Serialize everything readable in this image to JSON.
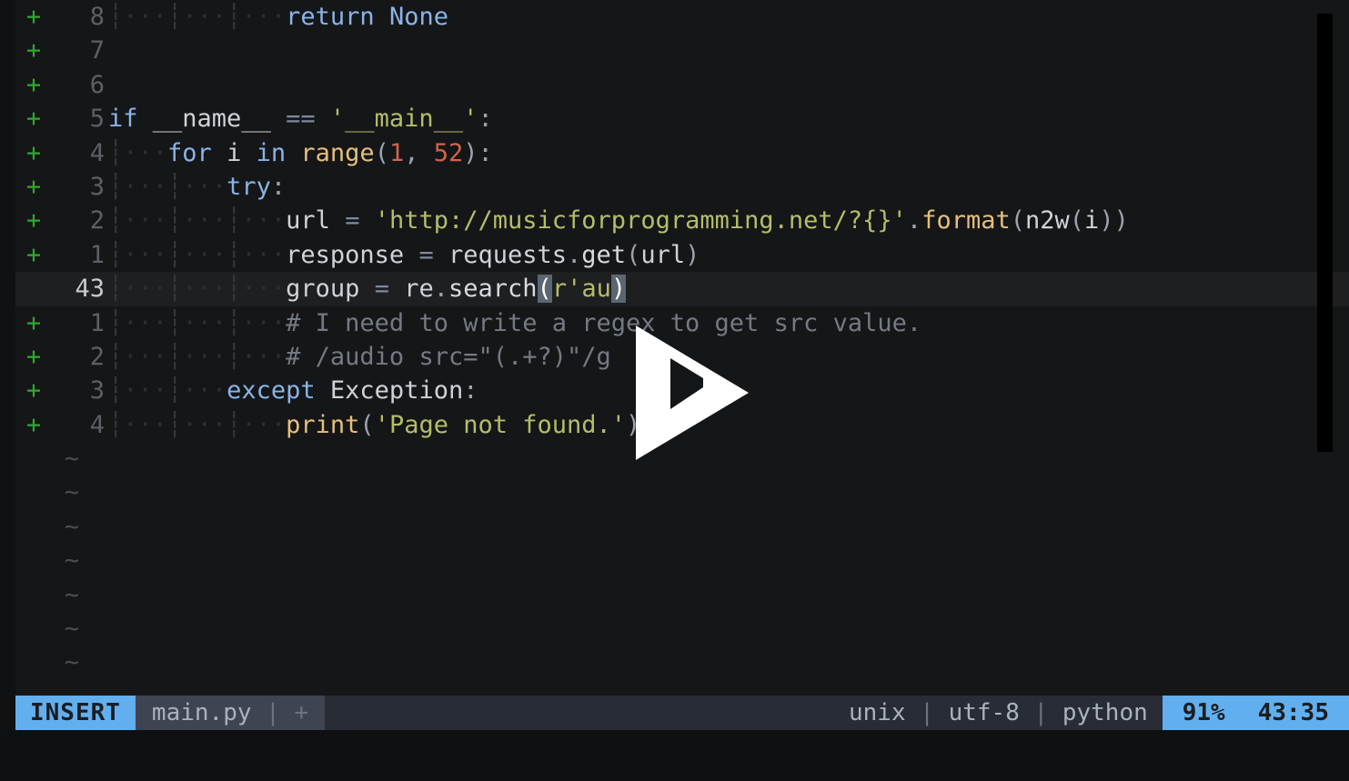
{
  "window": {
    "background": "#151618",
    "accent": "#61afef",
    "git_add_color": "#2fa82f"
  },
  "editor": {
    "filetype": "python",
    "current_line_number": "43",
    "lines": [
      {
        "sign": "+",
        "num": "8",
        "current": false,
        "indent_guides": 3,
        "code_tokens": [
          {
            "t": "return",
            "c": "kw"
          },
          {
            "t": " ",
            "c": "plain"
          },
          {
            "t": "None",
            "c": "builtin"
          }
        ]
      },
      {
        "sign": "+",
        "num": "7",
        "current": false,
        "indent_guides": 0,
        "code_tokens": []
      },
      {
        "sign": "+",
        "num": "6",
        "current": false,
        "indent_guides": 0,
        "code_tokens": []
      },
      {
        "sign": "+",
        "num": "5",
        "current": false,
        "indent_guides": 0,
        "code_tokens": [
          {
            "t": "if",
            "c": "kw"
          },
          {
            "t": " ",
            "c": "plain"
          },
          {
            "t": "__name__",
            "c": "ident"
          },
          {
            "t": " ",
            "c": "plain"
          },
          {
            "t": "==",
            "c": "op"
          },
          {
            "t": " ",
            "c": "plain"
          },
          {
            "t": "'__main__'",
            "c": "str"
          },
          {
            "t": ":",
            "c": "punct"
          }
        ]
      },
      {
        "sign": "+",
        "num": "4",
        "current": false,
        "indent_guides": 1,
        "code_tokens": [
          {
            "t": "for",
            "c": "kw"
          },
          {
            "t": " ",
            "c": "plain"
          },
          {
            "t": "i",
            "c": "ident"
          },
          {
            "t": " ",
            "c": "plain"
          },
          {
            "t": "in",
            "c": "kw"
          },
          {
            "t": " ",
            "c": "plain"
          },
          {
            "t": "range",
            "c": "fn"
          },
          {
            "t": "(",
            "c": "punct"
          },
          {
            "t": "1",
            "c": "num"
          },
          {
            "t": ", ",
            "c": "punct"
          },
          {
            "t": "52",
            "c": "num"
          },
          {
            "t": "):",
            "c": "punct"
          }
        ]
      },
      {
        "sign": "+",
        "num": "3",
        "current": false,
        "indent_guides": 2,
        "code_tokens": [
          {
            "t": "try",
            "c": "kw"
          },
          {
            "t": ":",
            "c": "punct"
          }
        ]
      },
      {
        "sign": "+",
        "num": "2",
        "current": false,
        "indent_guides": 3,
        "code_tokens": [
          {
            "t": "url",
            "c": "ident"
          },
          {
            "t": " ",
            "c": "plain"
          },
          {
            "t": "=",
            "c": "op"
          },
          {
            "t": " ",
            "c": "plain"
          },
          {
            "t": "'http://musicforprogramming.net/?{}'",
            "c": "str"
          },
          {
            "t": ".",
            "c": "punct"
          },
          {
            "t": "format",
            "c": "fn"
          },
          {
            "t": "(",
            "c": "punct"
          },
          {
            "t": "n2w",
            "c": "ident"
          },
          {
            "t": "(",
            "c": "punct"
          },
          {
            "t": "i",
            "c": "ident"
          },
          {
            "t": "))",
            "c": "punct"
          }
        ]
      },
      {
        "sign": "+",
        "num": "1",
        "current": false,
        "indent_guides": 3,
        "code_tokens": [
          {
            "t": "response",
            "c": "ident"
          },
          {
            "t": " ",
            "c": "plain"
          },
          {
            "t": "=",
            "c": "op"
          },
          {
            "t": " ",
            "c": "plain"
          },
          {
            "t": "requests",
            "c": "ident"
          },
          {
            "t": ".",
            "c": "punct"
          },
          {
            "t": "get",
            "c": "attr"
          },
          {
            "t": "(",
            "c": "punct"
          },
          {
            "t": "url",
            "c": "ident"
          },
          {
            "t": ")",
            "c": "punct"
          }
        ]
      },
      {
        "sign": "",
        "num": "43",
        "current": true,
        "indent_guides": 3,
        "code_tokens": [
          {
            "t": "group",
            "c": "ident"
          },
          {
            "t": " ",
            "c": "plain"
          },
          {
            "t": "=",
            "c": "op"
          },
          {
            "t": " ",
            "c": "plain"
          },
          {
            "t": "re",
            "c": "ident"
          },
          {
            "t": ".",
            "c": "punct"
          },
          {
            "t": "search",
            "c": "attr"
          },
          {
            "t": "(",
            "c": "match"
          },
          {
            "t": "r'au",
            "c": "str"
          },
          {
            "t": ")",
            "c": "match"
          }
        ]
      },
      {
        "sign": "+",
        "num": "1",
        "current": false,
        "indent_guides": 3,
        "code_tokens": [
          {
            "t": "# I need to write a regex to get src value.",
            "c": "comment"
          }
        ]
      },
      {
        "sign": "+",
        "num": "2",
        "current": false,
        "indent_guides": 3,
        "code_tokens": [
          {
            "t": "# /audio src=\"(.+?)\"/g",
            "c": "comment"
          }
        ]
      },
      {
        "sign": "+",
        "num": "3",
        "current": false,
        "indent_guides": 2,
        "code_tokens": [
          {
            "t": "except",
            "c": "kw"
          },
          {
            "t": " ",
            "c": "plain"
          },
          {
            "t": "Exception",
            "c": "exc"
          },
          {
            "t": ":",
            "c": "punct"
          }
        ]
      },
      {
        "sign": "+",
        "num": "4",
        "current": false,
        "indent_guides": 3,
        "code_tokens": [
          {
            "t": "print",
            "c": "fn"
          },
          {
            "t": "(",
            "c": "punct"
          },
          {
            "t": "'Page not found.'",
            "c": "str"
          },
          {
            "t": ")",
            "c": "punct"
          }
        ]
      }
    ],
    "empty_line_marker": "~",
    "empty_line_count": 7
  },
  "scrollbar": {
    "name": "vertical-scrollbar"
  },
  "cursor_overlay": {
    "icon": "play-cursor-icon"
  },
  "statusbar": {
    "mode": "INSERT",
    "filename": "main.py",
    "file_separator": "|",
    "modified_flag": "+",
    "fileformat": "unix",
    "encoding": "utf-8",
    "language": "python",
    "info_separator": "|",
    "percent": "91%",
    "position": "43:35"
  }
}
